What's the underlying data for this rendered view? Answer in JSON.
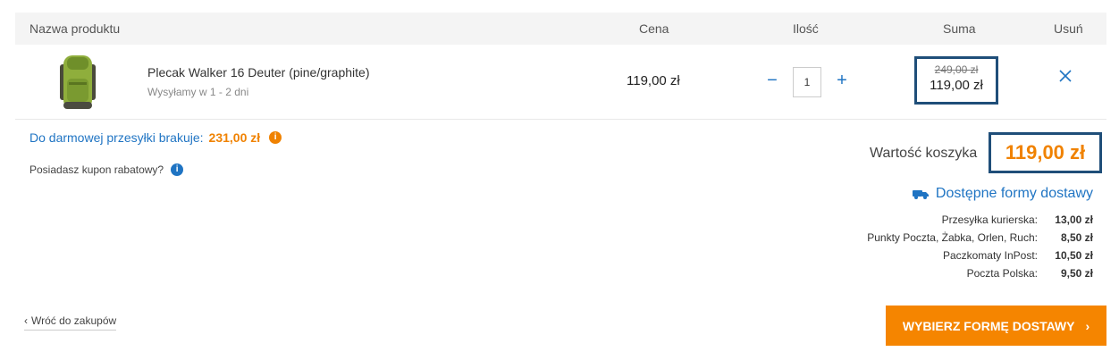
{
  "header": {
    "col_name": "Nazwa produktu",
    "col_price": "Cena",
    "col_qty": "Ilość",
    "col_sum": "Suma",
    "col_remove": "Usuń"
  },
  "item": {
    "name": "Plecak Walker 16 Deuter (pine/graphite)",
    "shipping": "Wysyłamy w 1 - 2 dni",
    "unit_price": "119,00 zł",
    "quantity": "1",
    "sum_old": "249,00 zł",
    "sum_new": "119,00 zł",
    "thumb_icon": "backpack-icon"
  },
  "free_shipping": {
    "label": "Do darmowej przesyłki brakuje:",
    "amount": "231,00 zł"
  },
  "coupon": {
    "label": "Posiadasz kupon rabatowy?"
  },
  "total": {
    "label": "Wartość koszyka",
    "value": "119,00 zł"
  },
  "delivery": {
    "heading": "Dostępne formy dostawy",
    "options": [
      {
        "label": "Przesyłka kurierska:",
        "price": "13,00 zł"
      },
      {
        "label": "Punkty Poczta, Żabka, Orlen, Ruch:",
        "price": "8,50 zł"
      },
      {
        "label": "Paczkomaty InPost:",
        "price": "10,50 zł"
      },
      {
        "label": "Poczta Polska:",
        "price": "9,50 zł"
      }
    ]
  },
  "back_link": "Wróć do zakupów",
  "cta": "WYBIERZ FORMĘ DOSTAWY",
  "colors": {
    "accent_blue": "#1f74c3",
    "accent_orange": "#f08200",
    "highlight_frame": "#1f4e79"
  }
}
